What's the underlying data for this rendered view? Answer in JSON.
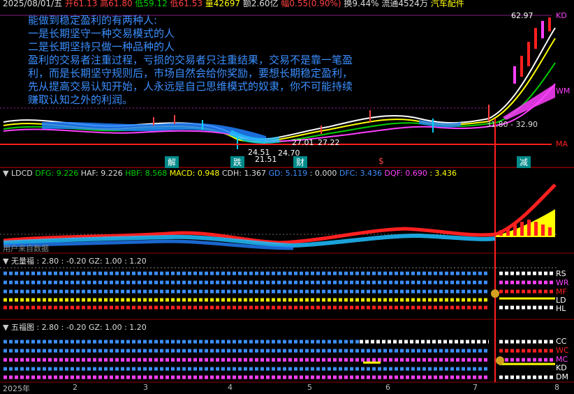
{
  "header": {
    "date": "2025/08/01/五",
    "open": "开61.13",
    "high": "高61.80",
    "low": "低59.12",
    "close_low": "低61.53",
    "volume": "量42697",
    "amount": "额2.60亿",
    "change": "幅0.55(0.90%)",
    "turnover": "换9.44%",
    "float": "流通4524万",
    "sector": "汽车配件"
  },
  "overlay_lines": [
    "能做到稳定盈利的有两种人:",
    "一是长期坚守一种交易模式的人",
    "二是长期坚持只做一种品种的人",
    "盈利的交易者注重过程，亏损的交易者只注重结果，交易不是靠一笔盈",
    "利，而是长期坚守规则后，市场自然会给你奖励，要想长期稳定盈利，",
    "先从提高交易认知开始，人永远是自己思维模式的奴隶，你不可能持续",
    "赚取认知之外的利润。"
  ],
  "main_chart": {
    "price_high_label": "62.97",
    "price_low_label_1": "24.51",
    "price_low_label_2": "21.51",
    "price_mid_label": "24.70",
    "price_label_a": "27.01",
    "price_label_b": "27.22",
    "range_label": "31.80 - 32.90",
    "right_tag_kd": "KD",
    "right_tag_wm": "WM",
    "right_tag_ma": "MA",
    "signal_labels": [
      "解",
      "跌",
      "财",
      "$",
      "减"
    ]
  },
  "ldcd": {
    "name": "LDCD",
    "dfg": "DFG: 9.226",
    "haf": "HAF: 9.226",
    "hbf": "HBF: 8.568",
    "macd": "MACD: 0.948",
    "cdh": "CDH: 1.367",
    "gd": "GD: 5.119",
    "zero": ": 0.000",
    "dfc": "DFC: 3.436",
    "dqf": "DQF: 0.690",
    "last": ": 3.436",
    "footer": "用户来自数据"
  },
  "wuliangfu": {
    "name": "无量福",
    "v1": ": 2.80",
    "v2": ": -0.20",
    "gz": "GZ: 1.00",
    "v3": ": 1.20",
    "right_tags": [
      "RS",
      "WR",
      "MF",
      "LD",
      "HL"
    ]
  },
  "wufutu": {
    "name": "五福图",
    "v1": ": 2.80",
    "v2": ": -0.20",
    "gz": "GZ: 1.00",
    "v3": ": 1.20",
    "right_tags": [
      "CC",
      "WC",
      "MC",
      "KD",
      "DM"
    ]
  },
  "x_axis": [
    "2025年",
    "2",
    "3",
    "4",
    "5",
    "6",
    "7",
    "8"
  ],
  "colors": {
    "background": "#000000",
    "grid_red": "#8a0000",
    "overlay_text": "#3b8fff",
    "up": "#ff2020",
    "down": "#00c8ff"
  }
}
